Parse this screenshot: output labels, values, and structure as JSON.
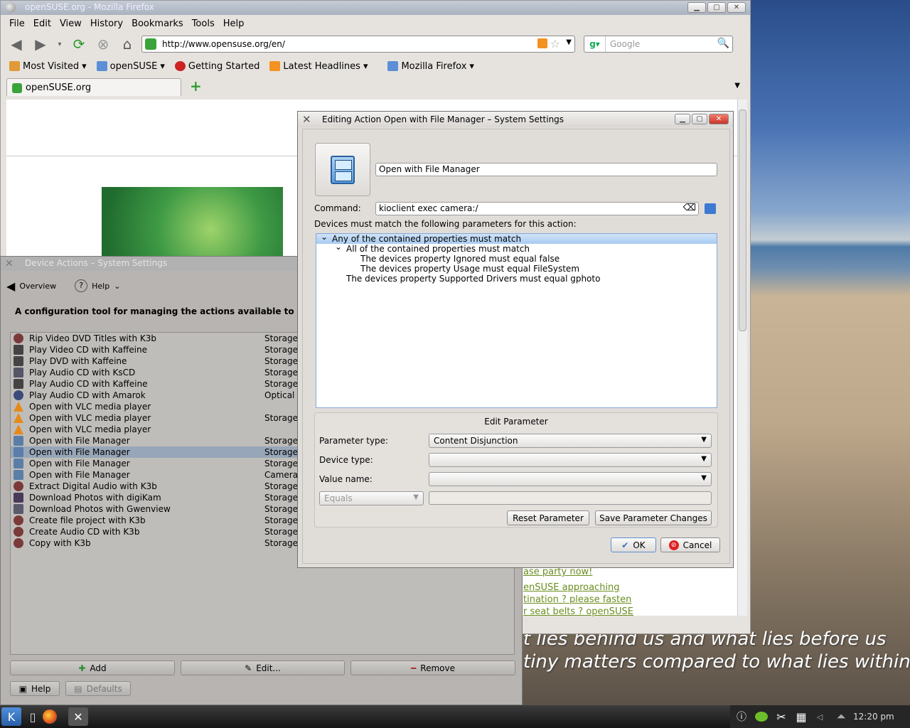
{
  "firefox": {
    "title": "openSUSE.org - Mozilla Firefox",
    "menu": [
      "File",
      "Edit",
      "View",
      "History",
      "Bookmarks",
      "Tools",
      "Help"
    ],
    "url": "http://www.opensuse.org/en/",
    "search_placeholder": "Google",
    "bookmarks": [
      "Most Visited",
      "openSUSE",
      "Getting Started",
      "Latest Headlines",
      "Mozilla Firefox"
    ],
    "tab_title": "openSUSE.org",
    "page_links": [
      "ase party now!",
      "enSUSE approaching",
      "tination ? please fasten",
      "r seat belts ? openSUSE"
    ]
  },
  "desktop": {
    "quote_line1": "t lies behind us and what lies before us",
    "quote_line2": "tiny matters compared to what lies within us."
  },
  "device_actions": {
    "title": "Device Actions – System Settings",
    "overview": "Overview",
    "help": "Help",
    "description": "A configuration tool for managing the actions available to the user whe",
    "actions": [
      {
        "name": "Rip Video DVD Titles with K3b",
        "type": "Storage",
        "icon": "k3b-icon"
      },
      {
        "name": "Play Video CD with Kaffeine",
        "type": "Storage",
        "icon": "kaffeine-icon"
      },
      {
        "name": "Play DVD with Kaffeine",
        "type": "Storage",
        "icon": "kaffeine-icon"
      },
      {
        "name": "Play Audio CD with KsCD",
        "type": "Storage",
        "icon": "kscd-icon"
      },
      {
        "name": "Play Audio CD with Kaffeine",
        "type": "Storage",
        "icon": "kaffeine-icon"
      },
      {
        "name": "Play Audio CD with Amarok",
        "type": "Optical D",
        "icon": "amarok-icon"
      },
      {
        "name": "Open with VLC media player",
        "type": "",
        "icon": "vlc-icon"
      },
      {
        "name": "Open with VLC media player",
        "type": "Storage",
        "icon": "vlc-icon"
      },
      {
        "name": "Open with VLC media player",
        "type": "",
        "icon": "vlc-icon"
      },
      {
        "name": "Open with File Manager",
        "type": "Storage A",
        "icon": "file-manager-icon"
      },
      {
        "name": "Open with File Manager",
        "type": "Storage",
        "icon": "file-manager-icon"
      },
      {
        "name": "Open with File Manager",
        "type": "Storage",
        "icon": "file-manager-icon"
      },
      {
        "name": "Open with File Manager",
        "type": "Camera",
        "icon": "file-manager-icon"
      },
      {
        "name": "Extract Digital Audio with K3b",
        "type": "Storage",
        "icon": "k3b-icon"
      },
      {
        "name": "Download Photos with digiKam",
        "type": "Storage",
        "icon": "digikam-icon"
      },
      {
        "name": "Download Photos with Gwenview",
        "type": "Storage",
        "icon": "gwenview-icon"
      },
      {
        "name": "Create file project with K3b",
        "type": "Storage",
        "icon": "k3b-icon"
      },
      {
        "name": "Create Audio CD with K3b",
        "type": "Storage",
        "icon": "k3b-icon"
      },
      {
        "name": "Copy with K3b",
        "type": "Storage",
        "icon": "k3b-icon"
      }
    ],
    "selected_index": 10,
    "add": "Add",
    "edit": "Edit...",
    "remove": "Remove",
    "help_btn": "Help",
    "defaults": "Defaults"
  },
  "dialog": {
    "title": "Editing Action Open with File Manager – System Settings",
    "action_name": "Open with File Manager",
    "command_label": "Command:",
    "command_value": "kioclient exec camera:/",
    "devices_label": "Devices must match the following parameters for this action:",
    "tree": [
      {
        "text": "Any of the contained properties must match",
        "level": 0,
        "selected": true
      },
      {
        "text": "All of the contained properties must match",
        "level": 1,
        "selected": false
      },
      {
        "text": "The devices property Ignored must equal false",
        "level": 2,
        "selected": false
      },
      {
        "text": "The devices property Usage must equal FileSystem",
        "level": 2,
        "selected": false
      },
      {
        "text": "The devices property Supported Drivers must equal gphoto",
        "level": 1,
        "selected": false
      }
    ],
    "edit_parameter_title": "Edit Parameter",
    "parameter_type_label": "Parameter type:",
    "parameter_type_value": "Content Disjunction",
    "device_type_label": "Device type:",
    "value_name_label": "Value name:",
    "equals": "Equals",
    "reset_parameter": "Reset Parameter",
    "save_parameter_changes": "Save Parameter Changes",
    "ok": "OK",
    "cancel": "Cancel"
  },
  "taskbar": {
    "clock": "12:20 pm"
  }
}
